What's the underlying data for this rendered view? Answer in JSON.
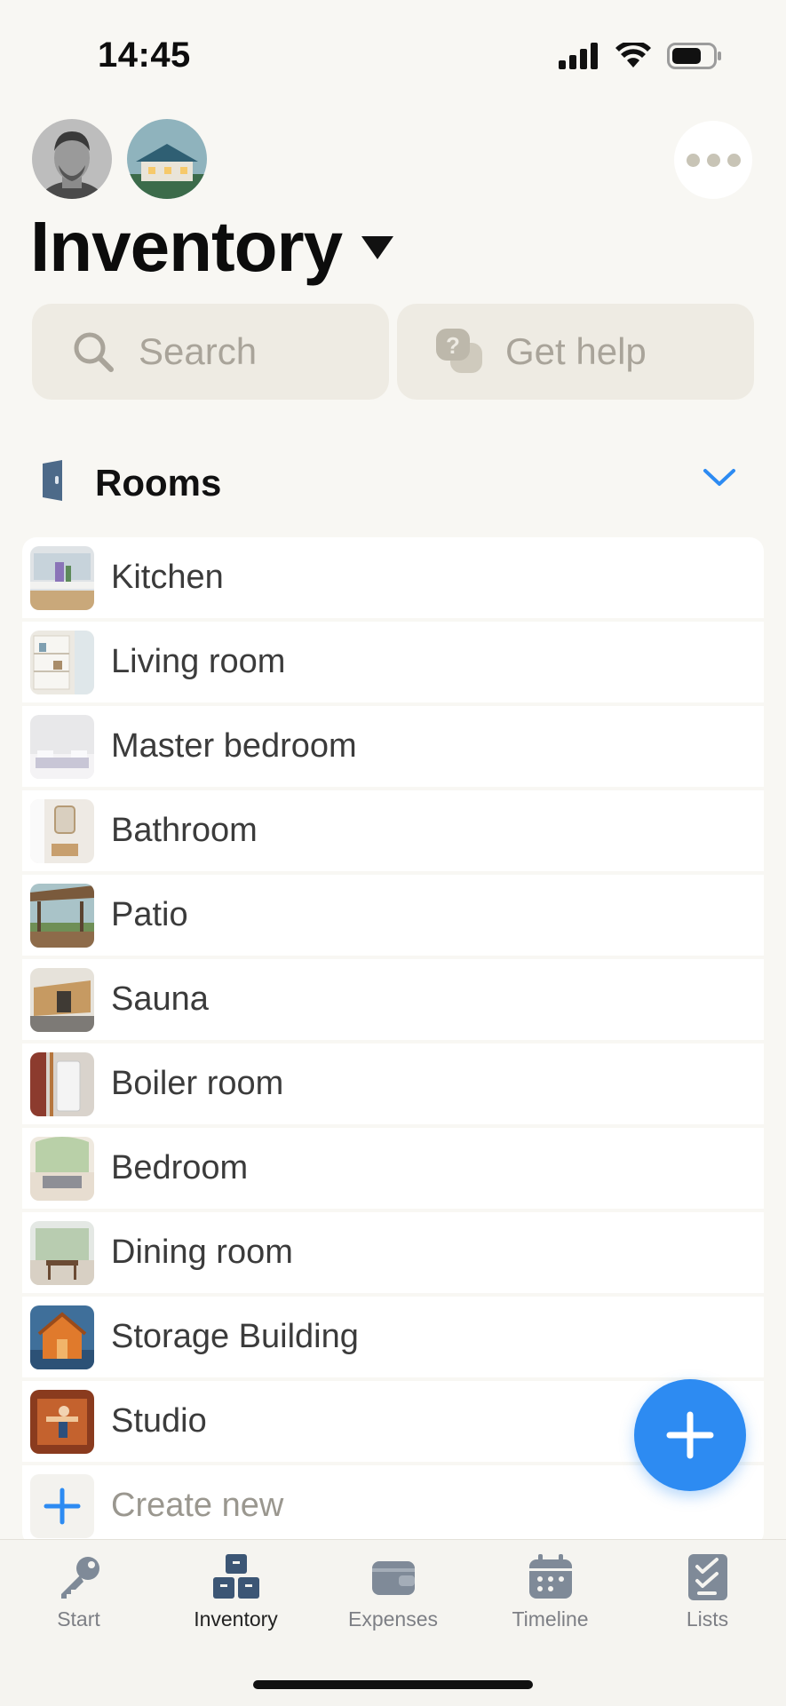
{
  "status_bar": {
    "time": "14:45"
  },
  "header": {
    "title": "Inventory"
  },
  "search": {
    "placeholder": "Search",
    "help_label": "Get help"
  },
  "section": {
    "title": "Rooms"
  },
  "rooms": [
    {
      "label": "Kitchen",
      "thumb": "kitchen"
    },
    {
      "label": "Living room",
      "thumb": "living"
    },
    {
      "label": "Master bedroom",
      "thumb": "master"
    },
    {
      "label": "Bathroom",
      "thumb": "bath"
    },
    {
      "label": "Patio",
      "thumb": "patio"
    },
    {
      "label": "Sauna",
      "thumb": "sauna"
    },
    {
      "label": "Boiler room",
      "thumb": "boiler"
    },
    {
      "label": "Bedroom",
      "thumb": "bedroom"
    },
    {
      "label": "Dining room",
      "thumb": "dining"
    },
    {
      "label": "Storage Building",
      "thumb": "storage"
    },
    {
      "label": "Studio",
      "thumb": "studio"
    }
  ],
  "create_new": {
    "label": "Create new"
  },
  "tabs": [
    {
      "label": "Start",
      "icon": "key-icon",
      "active": false
    },
    {
      "label": "Inventory",
      "icon": "inventory-icon",
      "active": true
    },
    {
      "label": "Expenses",
      "icon": "wallet-icon",
      "active": false
    },
    {
      "label": "Timeline",
      "icon": "calendar-icon",
      "active": false
    },
    {
      "label": "Lists",
      "icon": "checklist-icon",
      "active": false
    }
  ],
  "colors": {
    "accent": "#2d8bf2",
    "background": "#f8f7f3",
    "tab_icon": "#7f8a98",
    "tab_icon_active": "#3c5675"
  }
}
